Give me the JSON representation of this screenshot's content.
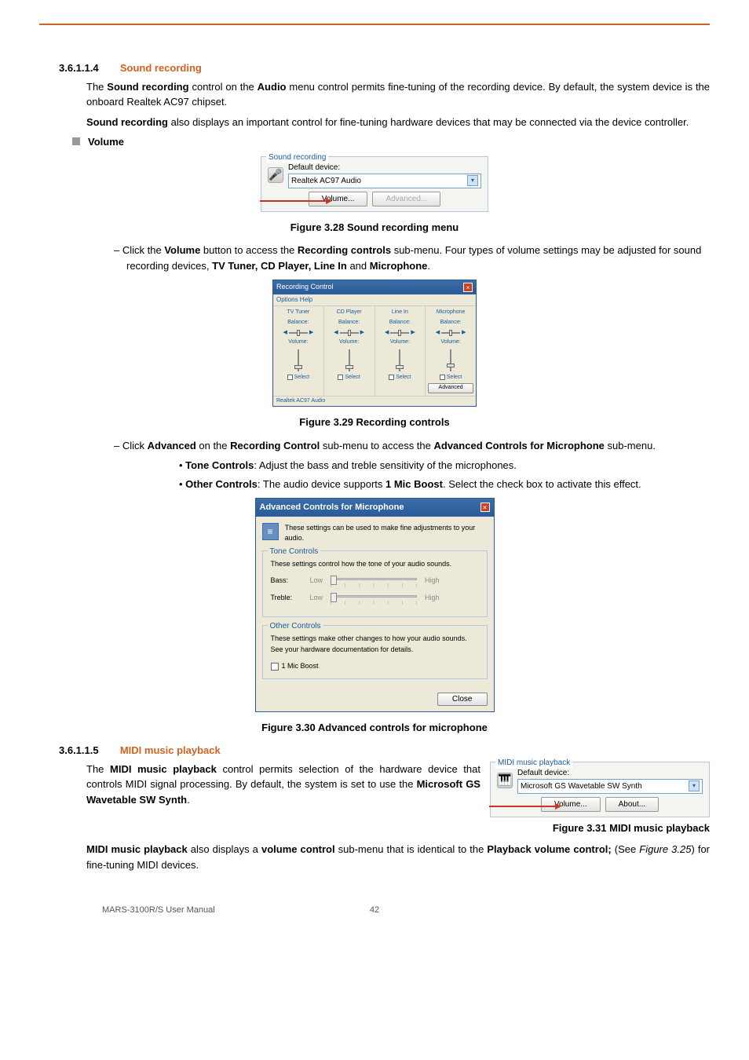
{
  "sections": {
    "sr": {
      "num": "3.6.1.1.4",
      "title": "Sound recording",
      "p1_a": "The ",
      "p1_b": "Sound recording",
      "p1_c": " control on the ",
      "p1_d": "Audio",
      "p1_e": " menu control permits fine-tuning of the recording device. By default, the system device is the onboard Realtek AC97 chipset.",
      "p2_a": "Sound recording",
      "p2_b": " also displays an important control for fine-tuning hardware devices that may be connected via the device controller.",
      "bullet": "Volume",
      "panel": {
        "title": "Sound recording",
        "default": "Default device:",
        "device": "Realtek AC97 Audio",
        "volume": "Volume...",
        "advanced": "Advanced..."
      },
      "caption1": "Figure 3.28 Sound recording menu",
      "sub1_a": "Click the ",
      "sub1_b": "Volume",
      "sub1_c": " button to access the ",
      "sub1_d": "Recording controls",
      "sub1_e": " sub-menu. Four types of volume settings may be adjusted for sound recording devices, ",
      "sub1_f": "TV Tuner, CD Player, Line In",
      "sub1_g": " and ",
      "sub1_h": "Microphone",
      "sub1_i": "."
    },
    "rc": {
      "title": "Recording Control",
      "menu": "Options   Help",
      "cols": [
        "TV Tuner",
        "CD Player",
        "Line In",
        "Microphone"
      ],
      "balance": "Balance:",
      "volume": "Volume:",
      "select": "Select",
      "advanced": "Advanced",
      "foot": "Realtek AC97 Audio",
      "caption": "Figure 3.29 Recording controls"
    },
    "adv": {
      "sub2_a": "Click ",
      "sub2_b": "Advanced",
      "sub2_c": " on the ",
      "sub2_d": "Recording Control",
      "sub2_e": " sub-menu to access the ",
      "sub2_f": "Advanced Controls for Microphone",
      "sub2_g": " sub-menu.",
      "tc_a": "Tone Controls",
      "tc_b": ": Adjust the bass and treble sensitivity of the microphones.",
      "oc_a": "Other Controls",
      "oc_b": ": The audio device supports ",
      "oc_c": "1 Mic Boost",
      "oc_d": ". Select the check box to activate this effect.",
      "dialog": {
        "title": "Advanced Controls for Microphone",
        "intro": "These settings can be used to make fine adjustments to your audio.",
        "tone_title": "Tone Controls",
        "tone_desc": "These settings control how the tone of your audio sounds.",
        "bass": "Bass:",
        "treble": "Treble:",
        "low": "Low",
        "high": "High",
        "other_title": "Other Controls",
        "other_desc": "These settings make other changes to how your audio sounds. See your hardware documentation for details.",
        "mic_boost": "1  Mic Boost",
        "close": "Close"
      },
      "caption": "Figure 3.30 Advanced controls for microphone"
    },
    "midi": {
      "num": "3.6.1.1.5",
      "title": "MIDI music playback",
      "p1_a": "The ",
      "p1_b": "MIDI music playback",
      "p1_c": " control permits selection of the hardware device that controls MIDI signal processing. By default, the system is set to use the ",
      "p1_d": "Microsoft GS Wavetable SW Synth",
      "p1_e": ".",
      "panel": {
        "title": "MIDI music playback",
        "default": "Default device:",
        "device": "Microsoft GS Wavetable SW Synth",
        "volume": "Volume...",
        "about": "About..."
      },
      "caption": "Figure 3.31 MIDI music playback",
      "p2_a": "MIDI music playback",
      "p2_b": " also displays a ",
      "p2_c": "volume control",
      "p2_d": " sub-menu that is identical to the ",
      "p2_e": "Playback volume control;",
      "p2_f": " (See ",
      "p2_g": "Figure 3.25",
      "p2_h": ") for fine-tuning MIDI devices."
    }
  },
  "footer": {
    "left": "MARS-3100R/S User Manual",
    "center": "42"
  }
}
